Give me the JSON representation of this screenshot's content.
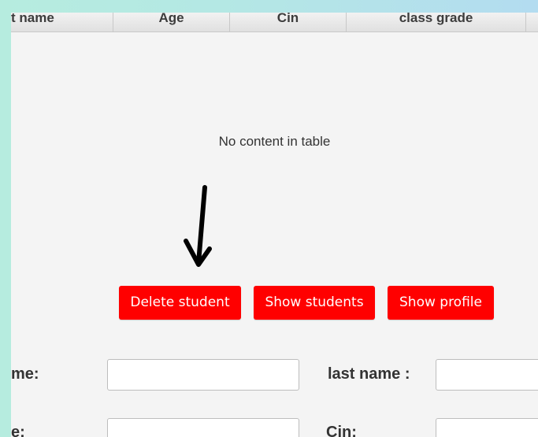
{
  "table": {
    "columns": [
      "t name",
      "Age",
      "Cin",
      "class grade"
    ],
    "empty_message": "No content in table"
  },
  "buttons": {
    "delete_student": "Delete student",
    "show_students": "Show students",
    "show_profile": "Show profile"
  },
  "form": {
    "first_name_label": "me:",
    "last_name_label": "last name :",
    "age_label": "e:",
    "cin_label": "Cin:",
    "first_name_value": "",
    "last_name_value": "",
    "age_value": "",
    "cin_value": ""
  },
  "colors": {
    "button_bg": "#ff0000",
    "annotation_arrow": "#000000"
  }
}
